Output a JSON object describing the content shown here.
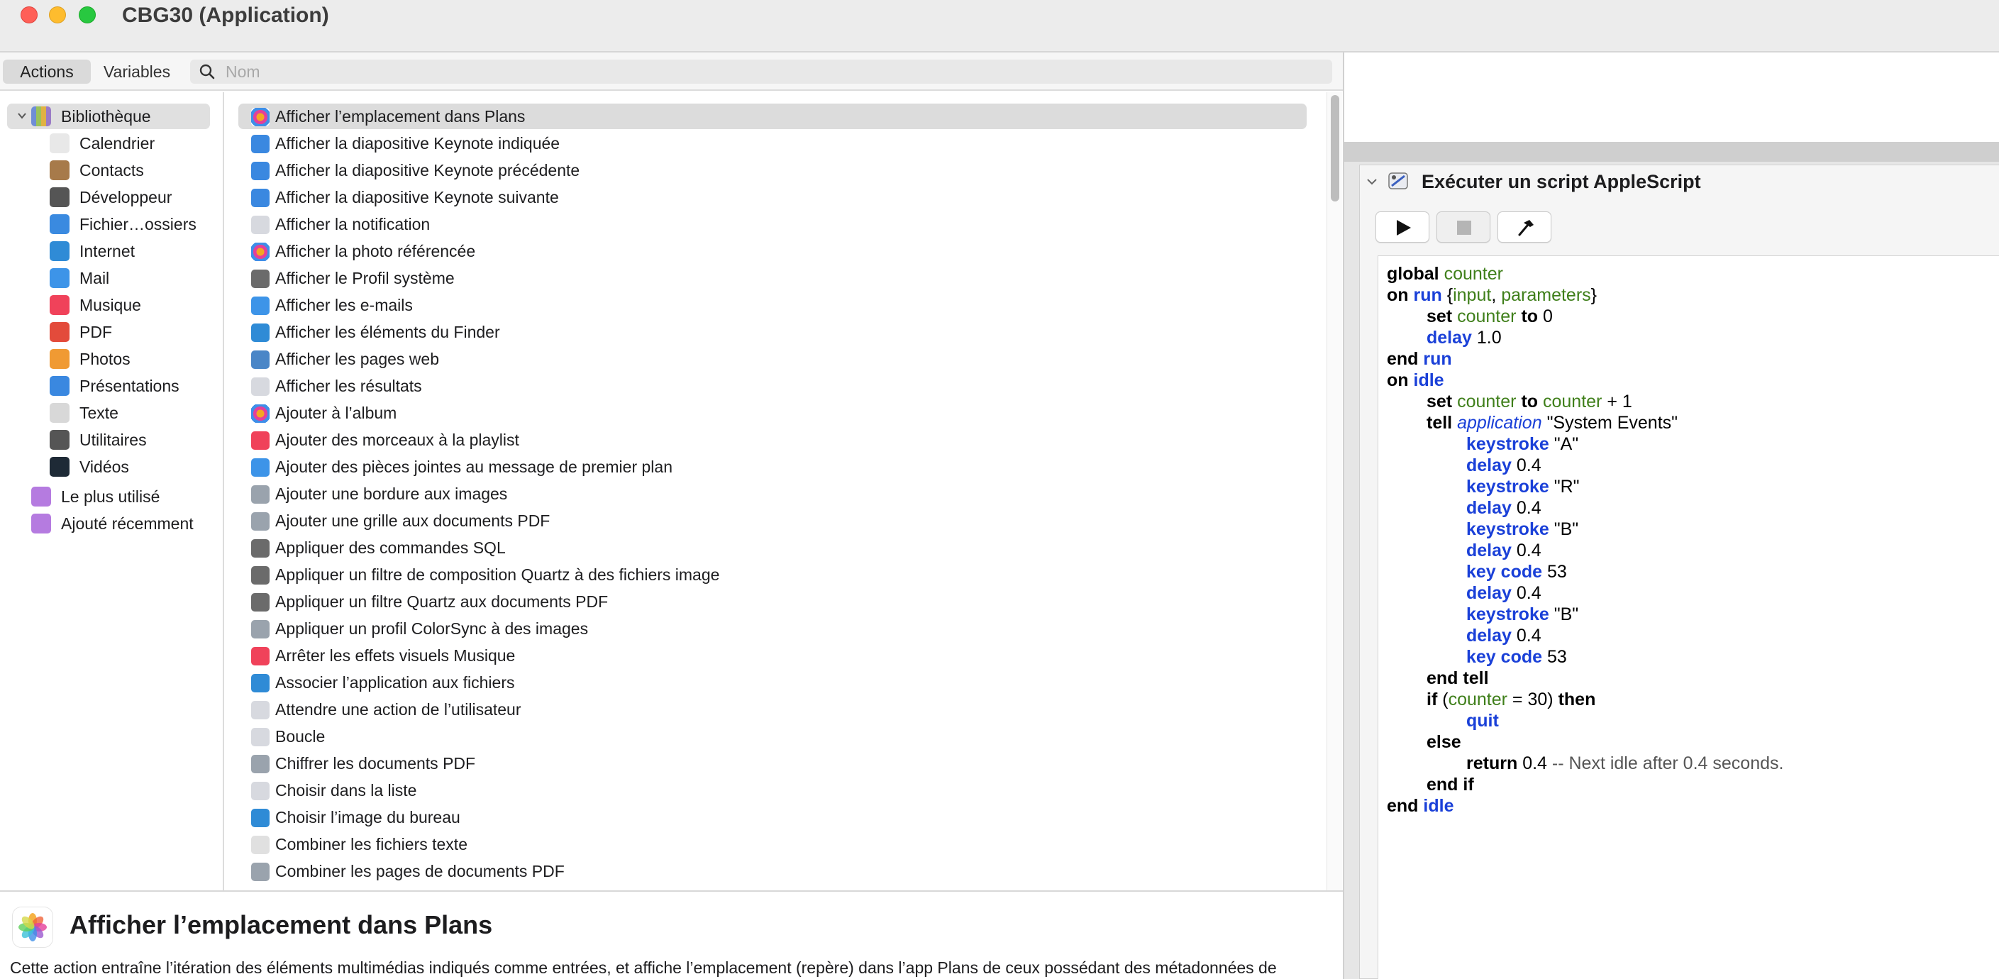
{
  "window": {
    "title": "CBG30 (Application)"
  },
  "tabs": {
    "actions": "Actions",
    "variables": "Variables"
  },
  "search": {
    "placeholder": "Nom",
    "value": ""
  },
  "library": {
    "root": "Bibliothèque",
    "items": [
      "Calendrier",
      "Contacts",
      "Développeur",
      "Fichier…ossiers",
      "Internet",
      "Mail",
      "Musique",
      "PDF",
      "Photos",
      "Présentations",
      "Texte",
      "Utilitaires",
      "Vidéos"
    ],
    "smart": [
      "Le plus utilisé",
      "Ajouté récemment"
    ]
  },
  "actions": [
    "Afficher l’emplacement dans Plans",
    "Afficher la diapositive Keynote indiquée",
    "Afficher la diapositive Keynote précédente",
    "Afficher la diapositive Keynote suivante",
    "Afficher la notification",
    "Afficher la photo référencée",
    "Afficher le Profil système",
    "Afficher les e-mails",
    "Afficher les éléments du Finder",
    "Afficher les pages web",
    "Afficher les résultats",
    "Ajouter à l’album",
    "Ajouter des morceaux à la playlist",
    "Ajouter des pièces jointes au message de premier plan",
    "Ajouter une bordure aux images",
    "Ajouter une grille aux documents PDF",
    "Appliquer des commandes SQL",
    "Appliquer un filtre de composition Quartz à des fichiers image",
    "Appliquer un filtre Quartz aux documents PDF",
    "Appliquer un profil ColorSync à des images",
    "Arrêter les effets visuels Musique",
    "Associer l’application aux fichiers",
    "Attendre une action de l’utilisateur",
    "Boucle",
    "Chiffrer les documents PDF",
    "Choisir dans la liste",
    "Choisir l’image du bureau",
    "Combiner les fichiers texte",
    "Combiner les pages de documents PDF"
  ],
  "description": {
    "title": "Afficher l’emplacement dans Plans",
    "text": "Cette action entraîne l’itération des éléments multimédias indiqués comme entrées, et affiche l’emplacement (repère) dans l’app Plans de ceux possédant des métadonnées de"
  },
  "workflow": {
    "action_title": "Exécuter un script AppleScript",
    "script": [
      "global counter",
      "on run {input, parameters}",
      "set counter to 0",
      "delay 1.0",
      "end run",
      "on idle",
      "set counter to counter + 1",
      "tell application \"System Events\"",
      "keystroke \"A\"",
      "delay 0.4",
      "keystroke \"R\"",
      "delay 0.4",
      "keystroke \"B\"",
      "delay 0.4",
      "key code 53",
      "delay 0.4",
      "keystroke \"B\"",
      "delay 0.4",
      "key code 53",
      "end tell",
      "if (counter = 30) then",
      "quit",
      "else",
      "return 0.4 -- Next idle after 0.4 seconds.",
      "end if",
      "end idle"
    ]
  },
  "colors": {
    "close": "#ff5f57",
    "minimize": "#febc2e",
    "maximize": "#28c840",
    "keyword_blue": "#1a40d8",
    "variable_green": "#3f7f1a",
    "selection": "#dcdcdc"
  },
  "icons": {
    "library": [
      "calendar-icon",
      "contacts-icon",
      "developer-tools-icon",
      "finder-icon",
      "internet-globe-icon",
      "mail-icon",
      "music-icon",
      "pdf-icon",
      "photos-icon",
      "keynote-icon",
      "text-icon",
      "utilities-icon",
      "quicktime-icon"
    ],
    "actions": [
      "photos-icon",
      "keynote-icon",
      "keynote-icon",
      "keynote-icon",
      "automator-icon",
      "photos-icon",
      "developer-tools-icon",
      "mail-icon",
      "finder-icon",
      "safari-icon",
      "automator-icon",
      "photos-icon",
      "music-icon",
      "mail-icon",
      "preview-icon",
      "preview-icon",
      "developer-tools-icon",
      "developer-tools-icon",
      "developer-tools-icon",
      "preview-icon",
      "music-icon",
      "finder-icon",
      "automator-icon",
      "automator-icon",
      "preview-icon",
      "automator-icon",
      "finder-icon",
      "text-icon",
      "preview-icon"
    ]
  }
}
